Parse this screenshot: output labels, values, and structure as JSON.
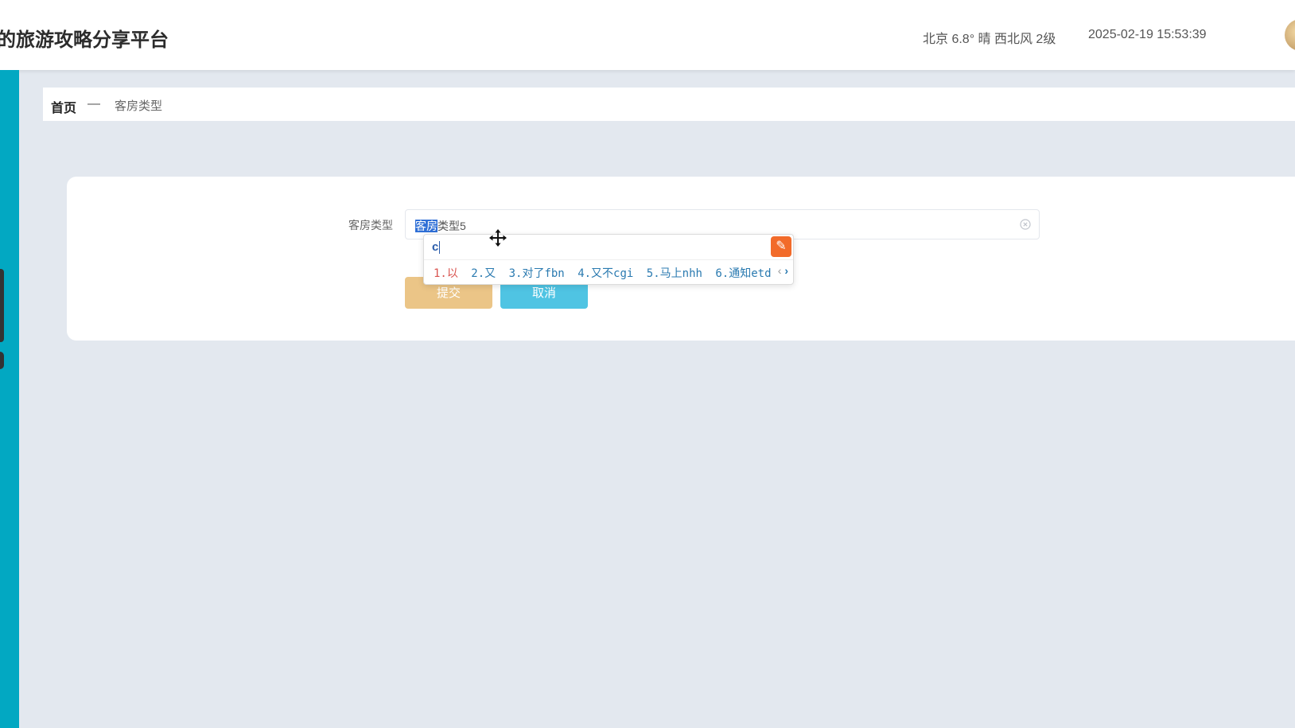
{
  "header": {
    "site_title": "的旅游攻略分享平台",
    "weather": "北京  6.8°  晴  西北风  2级",
    "datetime": "2025-02-19 15:53:39"
  },
  "breadcrumb": {
    "home": "首页",
    "separator": "—",
    "current": "客房类型"
  },
  "form": {
    "field_label": "客房类型",
    "input_value_selected": "客房",
    "input_value_rest": "类型5",
    "submit_label": "提交",
    "cancel_label": "取消"
  },
  "ime": {
    "composition": "c",
    "candidates": [
      "1.以",
      "2.又",
      "3.对了fbn",
      "4.又不cgi",
      "5.马上nhh",
      "6.通知etd"
    ],
    "prev_symbol": "‹",
    "next_symbol": "›"
  },
  "colors": {
    "accent_sidebar": "#02a8c2",
    "submit_button": "#ebc587",
    "cancel_button": "#4fc4e3",
    "background": "#e3e8ef"
  }
}
